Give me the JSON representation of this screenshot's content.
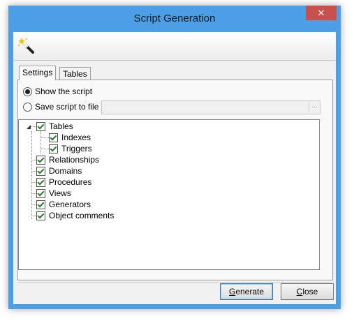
{
  "window": {
    "title": "Script Generation",
    "close_glyph": "✕"
  },
  "toolbar": {
    "icon": "magic-wand-icon"
  },
  "tabs": [
    {
      "label": "Settings",
      "active": true
    },
    {
      "label": "Tables",
      "active": false
    }
  ],
  "output": {
    "show_script_label": "Show the script",
    "save_to_file_label": "Save script to file",
    "selected": "show_script",
    "file_path": "",
    "browse_label": "..."
  },
  "tree": {
    "items": [
      {
        "label": "Tables",
        "checked": true,
        "expanded": true,
        "children": [
          {
            "label": "Indexes",
            "checked": true
          },
          {
            "label": "Triggers",
            "checked": true
          }
        ]
      },
      {
        "label": "Relationships",
        "checked": true
      },
      {
        "label": "Domains",
        "checked": true
      },
      {
        "label": "Procedures",
        "checked": true
      },
      {
        "label": "Views",
        "checked": true
      },
      {
        "label": "Generators",
        "checked": true
      },
      {
        "label": "Object comments",
        "checked": true
      }
    ]
  },
  "buttons": {
    "generate_first": "G",
    "generate_rest": "enerate",
    "close_first": "C",
    "close_rest": "lose"
  }
}
